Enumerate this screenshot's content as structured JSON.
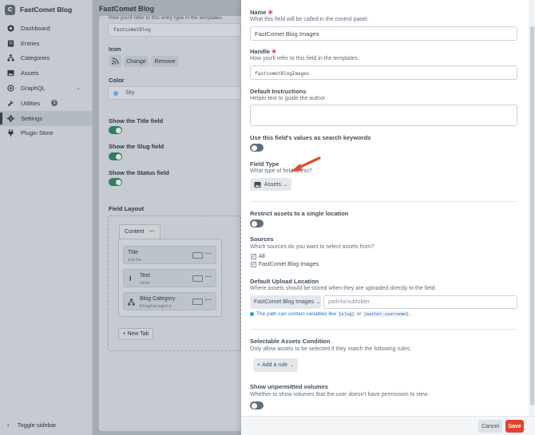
{
  "sidebar": {
    "logo_letter": "C",
    "site_name": "FastComet Blog",
    "items": [
      {
        "label": "Dashboard",
        "icon": "gauge-icon"
      },
      {
        "label": "Entries",
        "icon": "entries-icon"
      },
      {
        "label": "Categories",
        "icon": "categories-icon"
      },
      {
        "label": "Assets",
        "icon": "image-icon"
      },
      {
        "label": "GraphQL",
        "icon": "graphql-icon"
      },
      {
        "label": "Utilities",
        "icon": "wrench-icon",
        "badge": "1"
      },
      {
        "label": "Settings",
        "icon": "gear-icon"
      },
      {
        "label": "Plugin Store",
        "icon": "plug-icon"
      }
    ],
    "toggle_label": "Toggle sidebar"
  },
  "background": {
    "header": "FastComet Blog",
    "handle_help": "How you'll refer to this entry type in the templates.",
    "handle_value": "fastcometBlog",
    "icon_label": "Icon",
    "change_button": "Change",
    "remove_button": "Remove",
    "color_label": "Color",
    "color_value": "Sky",
    "show_title_label": "Show the Title field",
    "show_slug_label": "Show the Slug field",
    "show_status_label": "Show the Status field",
    "field_layout_label": "Field Layout",
    "tab_label": "Content",
    "layout_fields": [
      {
        "name": "Title",
        "handle": "title"
      },
      {
        "name": "Text",
        "handle": "text"
      },
      {
        "name": "Blog Category",
        "handle": "blogCategory"
      }
    ],
    "new_tab": "+ New Tab"
  },
  "panel": {
    "name_label": "Name",
    "name_help": "What this field will be called in the control panel.",
    "name_value": "FastComet Blog Images",
    "handle_label": "Handle",
    "handle_help": "How you'll refer to this field in the templates.",
    "handle_value": "fastcometBlogImages",
    "instructions_label": "Default Instructions",
    "instructions_help": "Helper text to guide the author.",
    "keywords_label": "Use this field's values as search keywords",
    "field_type_label": "Field Type",
    "field_type_help": "What type of field is this?",
    "field_type_value": "Assets",
    "restrict_label": "Restrict assets to a single location",
    "sources_label": "Sources",
    "sources_help": "Which sources do you want to select assets from?",
    "sources": [
      {
        "label": "All",
        "checked": true
      },
      {
        "label": "FastComet Blog Images",
        "checked": true
      }
    ],
    "upload_label": "Default Upload Location",
    "upload_help": "Where assets should be stored when they are uploaded directly to the field.",
    "upload_volume": "FastComet Blog Images",
    "upload_path_placeholder": "path/to/subfolder",
    "tip_text": "The path can contain variables like",
    "tip_code1": "{slug}",
    "tip_or": "or",
    "tip_code2": "{author.username}",
    "tip_end": ".",
    "condition_label": "Selectable Assets Condition",
    "condition_help": "Only allow assets to be selected if they match the following rules:",
    "add_rule": "Add a rule",
    "unpermitted_label": "Show unpermitted volumes",
    "unpermitted_help": "Whether to show volumes that the user doesn't have permission to view.",
    "cancel_button": "Cancel",
    "save_button": "Save"
  },
  "colors": {
    "accent": "#e5422b",
    "toggle_on": "#2f7d5f",
    "link": "#2b6fc1",
    "required": "#e0314b"
  }
}
